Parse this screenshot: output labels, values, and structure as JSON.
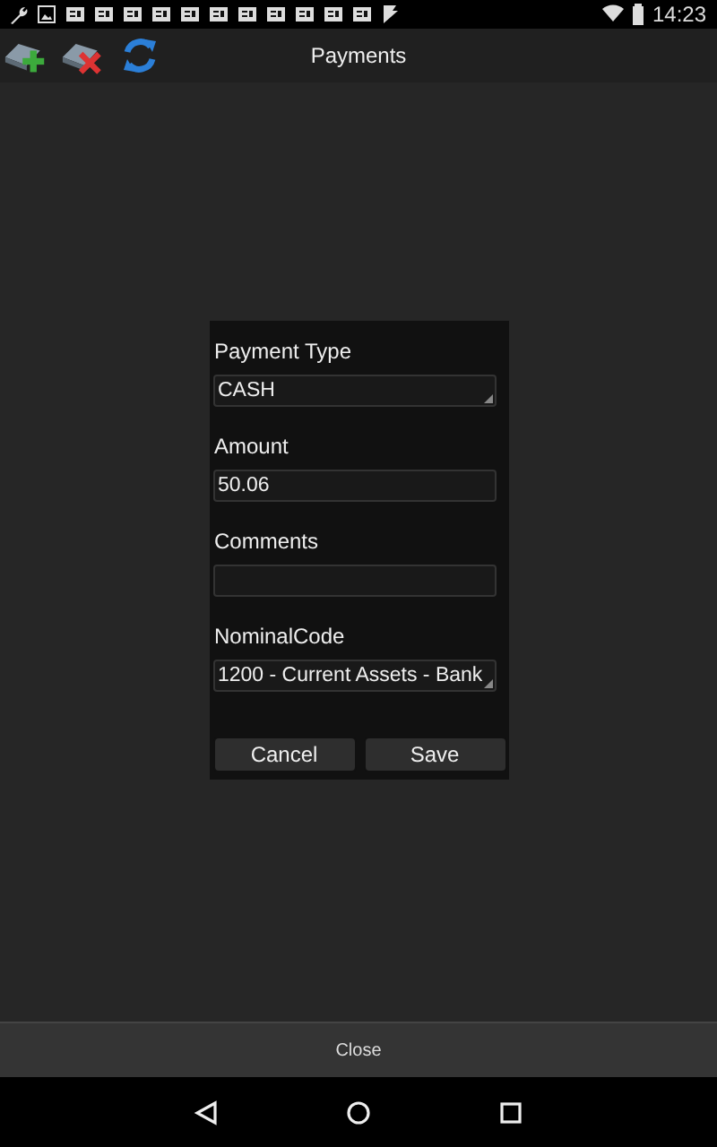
{
  "status_bar": {
    "time": "14:23"
  },
  "toolbar": {
    "title": "Payments"
  },
  "dialog": {
    "fields": [
      {
        "label": "Payment Type",
        "kind": "dropdown",
        "value": "CASH"
      },
      {
        "label": "Amount",
        "kind": "text",
        "value": "50.06"
      },
      {
        "label": "Comments",
        "kind": "text"
      },
      {
        "label": "NominalCode",
        "kind": "dropdown",
        "value": "1200 - Current Assets - Bank"
      }
    ],
    "buttons": [
      "Cancel",
      "Save"
    ]
  },
  "bottom_bar": {
    "button": "Close"
  }
}
